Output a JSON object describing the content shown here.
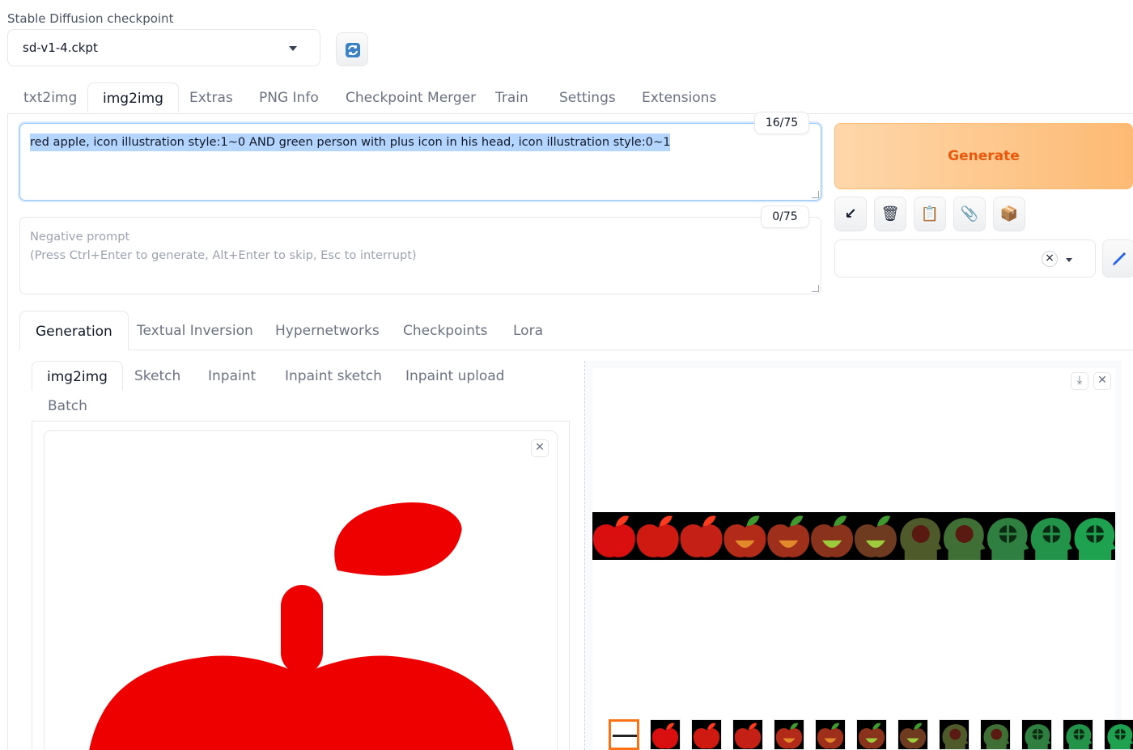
{
  "checkpoint": {
    "label": "Stable Diffusion checkpoint",
    "value": "sd-v1-4.ckpt"
  },
  "main_tabs": [
    {
      "label": "txt2img"
    },
    {
      "label": "img2img",
      "active": true
    },
    {
      "label": "Extras"
    },
    {
      "label": "PNG Info"
    },
    {
      "label": "Checkpoint Merger"
    },
    {
      "label": "Train"
    },
    {
      "label": "Settings"
    },
    {
      "label": "Extensions"
    }
  ],
  "prompt": {
    "value": "red apple, icon illustration style:1~0 AND green person with plus icon in his head, icon illustration style:0~1",
    "counter": "16/75"
  },
  "negative_prompt": {
    "placeholder_line1": "Negative prompt",
    "placeholder_line2": "(Press Ctrl+Enter to generate, Alt+Enter to skip, Esc to interrupt)",
    "counter": "0/75"
  },
  "generate": {
    "label": "Generate"
  },
  "tool_buttons": [
    {
      "icon": "arrow-down-left-icon",
      "glyph": "↙"
    },
    {
      "icon": "trash-icon",
      "glyph": "🗑"
    },
    {
      "icon": "clipboard-icon",
      "glyph": "📋"
    },
    {
      "icon": "paperclip-icon",
      "glyph": "📎"
    },
    {
      "icon": "package-icon",
      "glyph": "📦"
    }
  ],
  "styles_select": {
    "clear_glyph": "×"
  },
  "extra_tabs": [
    {
      "label": "Generation",
      "active": true
    },
    {
      "label": "Textual Inversion"
    },
    {
      "label": "Hypernetworks"
    },
    {
      "label": "Checkpoints"
    },
    {
      "label": "Lora"
    }
  ],
  "input_tabs": [
    {
      "label": "img2img",
      "active": true
    },
    {
      "label": "Sketch"
    },
    {
      "label": "Inpaint"
    },
    {
      "label": "Inpaint sketch"
    },
    {
      "label": "Inpaint upload"
    },
    {
      "label": "Batch"
    }
  ],
  "colors": {
    "accent": "#f97316",
    "apple_red": "#ee0000",
    "generate_text": "#ea580c",
    "selection": "#b4d5fe"
  },
  "gallery": {
    "image_count": 12,
    "frames": [
      {
        "kind": "apple",
        "tone": "#d90f0f"
      },
      {
        "kind": "apple",
        "tone": "#cf1a12"
      },
      {
        "kind": "apple",
        "tone": "#c52015"
      },
      {
        "kind": "apple",
        "tone": "#b22a18"
      },
      {
        "kind": "apple",
        "tone": "#9e2f1a"
      },
      {
        "kind": "apple",
        "tone": "#8a331c"
      },
      {
        "kind": "apple",
        "tone": "#6e3a20"
      },
      {
        "kind": "head",
        "tone": "#4f5a2a"
      },
      {
        "kind": "head",
        "tone": "#3f6f35"
      },
      {
        "kind": "head",
        "tone": "#2f8040"
      },
      {
        "kind": "head",
        "tone": "#24934a"
      },
      {
        "kind": "head",
        "tone": "#1ea24f"
      }
    ]
  }
}
